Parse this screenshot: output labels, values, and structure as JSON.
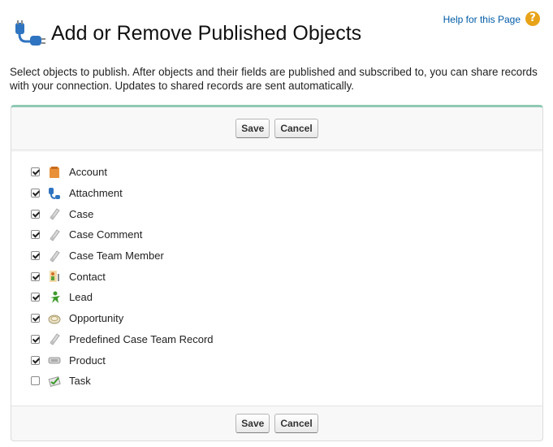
{
  "page": {
    "title": "Add or Remove Published Objects",
    "help_link": "Help for this Page",
    "help_icon": "question-circle-icon",
    "title_icon": "connection-plug-icon",
    "description": "Select objects to publish. After objects and their fields are published and subscribed to, you can share records with your connection. Updates to shared records are sent automatically."
  },
  "buttons": {
    "save": "Save",
    "cancel": "Cancel"
  },
  "colors": {
    "accent_border": "#8fc9b3",
    "link": "#015ba7",
    "help_icon": "#e8a319"
  },
  "objects": [
    {
      "label": "Account",
      "checked": true,
      "icon": "account-folder-icon"
    },
    {
      "label": "Attachment",
      "checked": true,
      "icon": "attachment-plug-icon"
    },
    {
      "label": "Case",
      "checked": true,
      "icon": "case-briefcase-icon"
    },
    {
      "label": "Case Comment",
      "checked": true,
      "icon": "case-comment-icon"
    },
    {
      "label": "Case Team Member",
      "checked": true,
      "icon": "case-team-member-icon"
    },
    {
      "label": "Contact",
      "checked": true,
      "icon": "contact-card-icon"
    },
    {
      "label": "Lead",
      "checked": true,
      "icon": "lead-person-icon"
    },
    {
      "label": "Opportunity",
      "checked": true,
      "icon": "opportunity-coin-icon"
    },
    {
      "label": "Predefined Case Team Record",
      "checked": true,
      "icon": "predefined-case-team-icon"
    },
    {
      "label": "Product",
      "checked": true,
      "icon": "product-box-icon"
    },
    {
      "label": "Task",
      "checked": false,
      "icon": "task-checklist-icon"
    }
  ]
}
